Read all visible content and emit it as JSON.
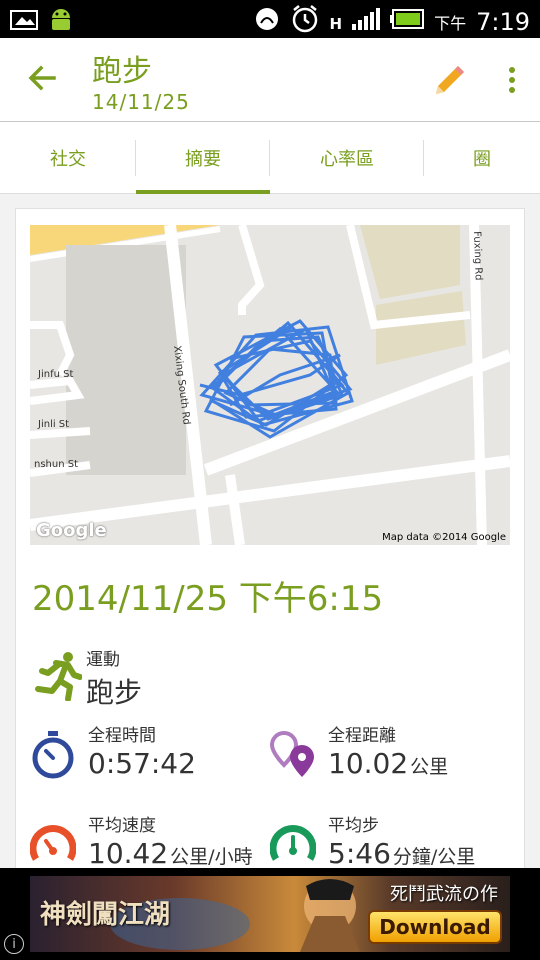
{
  "statusbar": {
    "ampm": "下午",
    "time": "7:19",
    "network": "H"
  },
  "appbar": {
    "title": "跑步",
    "subtitle": "14/11/25"
  },
  "tabs": [
    {
      "label": "社交"
    },
    {
      "label": "摘要"
    },
    {
      "label": "心率區"
    },
    {
      "label": "圈"
    }
  ],
  "map": {
    "streets": [
      "Xixing South Rd",
      "Fuxing Rd",
      "Jinfu St",
      "Jinli St",
      "nshun St"
    ],
    "logo": "Google",
    "credit": "Map data ©2014 Google"
  },
  "workout": {
    "datetime": "2014/11/25 下午6:15",
    "sport_label": "運動",
    "sport_value": "跑步",
    "duration_label": "全程時間",
    "duration_value": "0:57:42",
    "distance_label": "全程距離",
    "distance_value": "10.02",
    "distance_unit": "公里",
    "speed_label": "平均速度",
    "speed_value": "10.42",
    "speed_unit": "公里/小時",
    "pace_label": "平均步",
    "pace_value": "5:46",
    "pace_unit": "分鐘/公里"
  },
  "ad": {
    "title": "神劍闖江湖",
    "slogan": "死鬥武流の作",
    "download": "Download",
    "info": "i"
  },
  "colors": {
    "accent": "#7a9e1f",
    "route": "#3a7be0",
    "duration_icon": "#2f4a9a",
    "distance_icon": "#8a3a9a",
    "speed_icon": "#e8502a",
    "pace_icon": "#1a9a5a"
  },
  "icons": {
    "back": "arrow-back-icon",
    "edit": "pencil-icon",
    "more": "overflow-menu-icon",
    "sport": "runner-icon",
    "duration": "stopwatch-icon",
    "distance": "location-pins-icon",
    "speed": "speedometer-icon",
    "pace": "pace-gauge-icon"
  }
}
